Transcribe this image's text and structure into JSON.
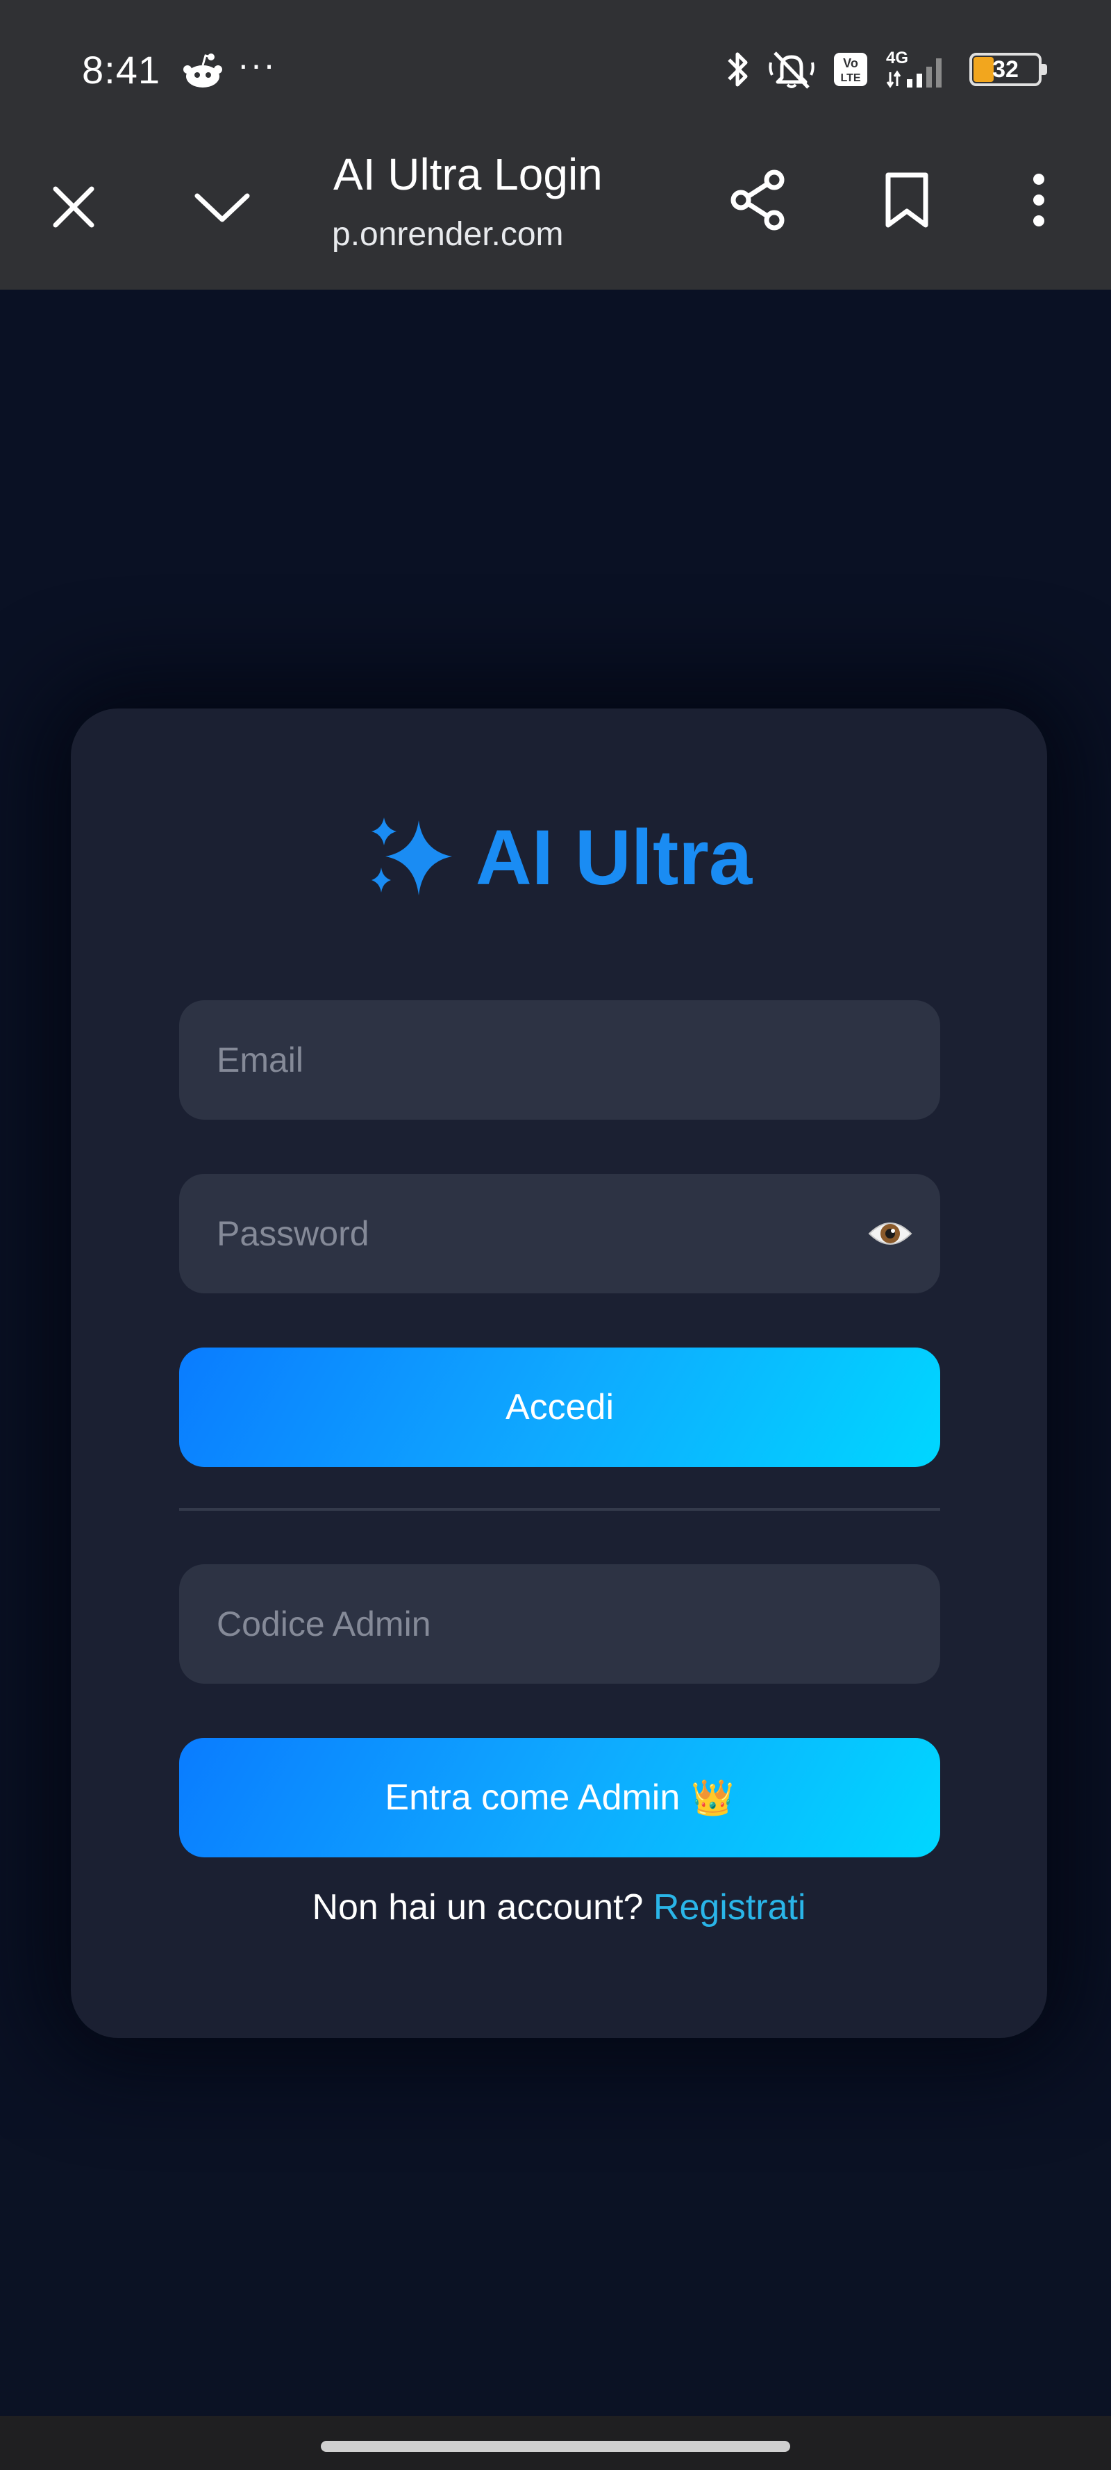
{
  "status_bar": {
    "time": "8:41",
    "more_glyph": "···",
    "app_icon": "reddit-icon",
    "bluetooth_icon": "bluetooth-icon",
    "mute_icon": "notifications-off-icon",
    "volte_icon": "volte-icon",
    "network_label": "4G",
    "signal_icon": "cell-signal-icon",
    "battery_level": "32",
    "battery_fill_percent": 32,
    "battery_color": "#f2a61e"
  },
  "browser": {
    "close_icon": "close-icon",
    "collapse_icon": "chevron-down-icon",
    "title": "AI Ultra Login",
    "url": "p.onrender.com",
    "share_icon": "share-icon",
    "bookmark_icon": "bookmark-icon",
    "menu_icon": "more-vert-icon"
  },
  "login_card": {
    "brand_icon": "sparkles-icon",
    "brand_name": "AI Ultra",
    "brand_color": "#1a8cf3",
    "email_placeholder": "Email",
    "password_placeholder": "Password",
    "password_toggle_icon": "eye-icon",
    "login_button": "Accedi",
    "admin_code_placeholder": "Codice Admin",
    "admin_button": "Entra come Admin",
    "admin_button_icon": "crown-icon",
    "admin_button_emoji": "👑",
    "no_account_text": "Non hai un account?",
    "register_link": "Registrati",
    "link_color": "#2ab5e8",
    "button_gradient": [
      "#0a7cff",
      "#00d7ff"
    ]
  }
}
